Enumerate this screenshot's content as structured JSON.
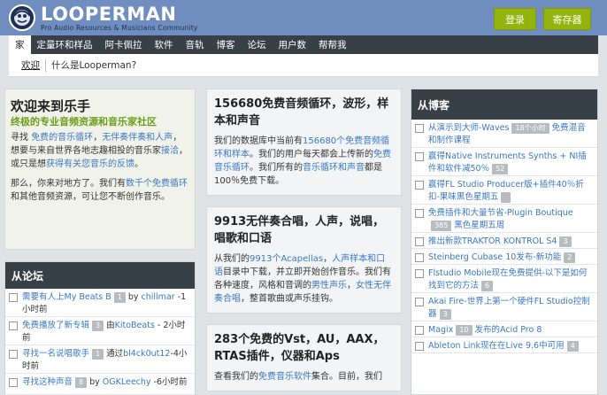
{
  "header": {
    "logo_title": "LOOPERMAN",
    "logo_subtitle": "Pro Audio Resources & Musicians Community",
    "login_label": "登录",
    "register_label": "寄存器",
    "accent_color": "#94b30c"
  },
  "nav": {
    "items": [
      "家",
      "定量环和样品",
      "阿卡佩拉",
      "软件",
      "音轨",
      "博客",
      "论坛",
      "用户数",
      "帮帮我"
    ],
    "active": "家"
  },
  "subnav": {
    "items": [
      "欢迎",
      "什么是Looperman?"
    ]
  },
  "welcome": {
    "title": "欢迎来到乐手",
    "subtitle": "终极的专业音频资源和音乐家社区",
    "p1_a": "寻找 ",
    "p1_link1": "免费的音乐循环",
    "p1_b": "，",
    "p1_link2": "无伴奏伴奏和人声",
    "p1_c": "，想要与来自世界各地志趣相投的音乐家",
    "p1_link3": "接洽",
    "p1_d": "，或只是想",
    "p1_link4": "获得有关您音乐的反馈",
    "p1_e": "。",
    "p2_a": "那么，你来对地方了。我们有",
    "p2_link1": "数千个免费循环",
    "p2_b": "和其他音频资源，可让您不断创作音乐。"
  },
  "forum": {
    "title": "从论坛",
    "items": [
      {
        "link": "需要有人上My Beats B",
        "count": "1",
        "by": "by ",
        "user": "chillmar",
        "time": " -1小时前"
      },
      {
        "link": "免费播放了新专辑",
        "count": "3",
        "by": "由",
        "user": "KitoBeats",
        "time": " - 2小时前"
      },
      {
        "link": "寻找一名说唱歌手",
        "count": "1",
        "by": "通过",
        "user": "bl4ck0ut12",
        "time": "-4小时前"
      },
      {
        "link": "寻找这种声音",
        "count": "8",
        "by": "by ",
        "user": "OGKLeechy",
        "time": " -6小时前"
      }
    ]
  },
  "cards": [
    {
      "title": "156680免费音频循环，波形，样本和声音",
      "p_a": "我们的数据库中当前有",
      "p_link1": "156680个免费音频循环和样本",
      "p_b": "。我们的用户每天都会上传新的",
      "p_link2": "免费音乐循环",
      "p_c": "。我们所有的",
      "p_link3": "音乐循环和声音",
      "p_d": "都是100％免费下载。"
    },
    {
      "title": "9913无伴奏合唱，人声，说唱，唱歌和口语",
      "p_a": "从我们的",
      "p_link1": "9913个Acapellas",
      "p_b": "，",
      "p_link2": "人声样本和口语",
      "p_c": "目录中下载，并立即开始创作音乐。我们有各种速度，风格和音调的",
      "p_link3": "男性声乐",
      "p_d": "，",
      "p_link4": "女性无伴奏合唱",
      "p_e": "，整首歌曲或声乐挂钩。"
    },
    {
      "title": "283个免费的Vst，AU，AAX，RTAS插件，仪器和Aps",
      "p_a": "查看我们的",
      "p_link1": "免费音乐软件",
      "p_b": "集合。目前，我们"
    }
  ],
  "blog": {
    "title": "从博客",
    "items": [
      {
        "text": "从演示到大师-Waves",
        "count": "18个小时",
        "text2": "免费混音和制作课程"
      },
      {
        "text": "赢得Native Instruments Synths + NI插件和软件减50％",
        "count": "52",
        "text2": ""
      },
      {
        "text": "赢得FL Studio Producer版+插件40％折扣-果味黑色星期五",
        "count": "",
        "text2": ""
      },
      {
        "text": "免费插件和大量节省-Plugin Boutique",
        "count": "385",
        "text2": "黑色星期五周"
      },
      {
        "text": "推出新款TRAKTOR KONTROL S4",
        "count": "3",
        "text2": ""
      },
      {
        "text": "Steinberg Cubase 10发布-新功能",
        "count": "2",
        "text2": ""
      },
      {
        "text": "Flstudio Mobile现在免费提供-以下是如何找到它的方法",
        "count": "6",
        "text2": ""
      },
      {
        "text": "Akai Fire-世界上第一个硬件FL Studio控制器",
        "count": "3",
        "text2": ""
      },
      {
        "text": "Magix",
        "count": "10",
        "text2": "发布的Acid Pro 8"
      },
      {
        "text": "Ableton Link现在在Live 9.6中可用",
        "count": "4",
        "text2": ""
      }
    ]
  }
}
